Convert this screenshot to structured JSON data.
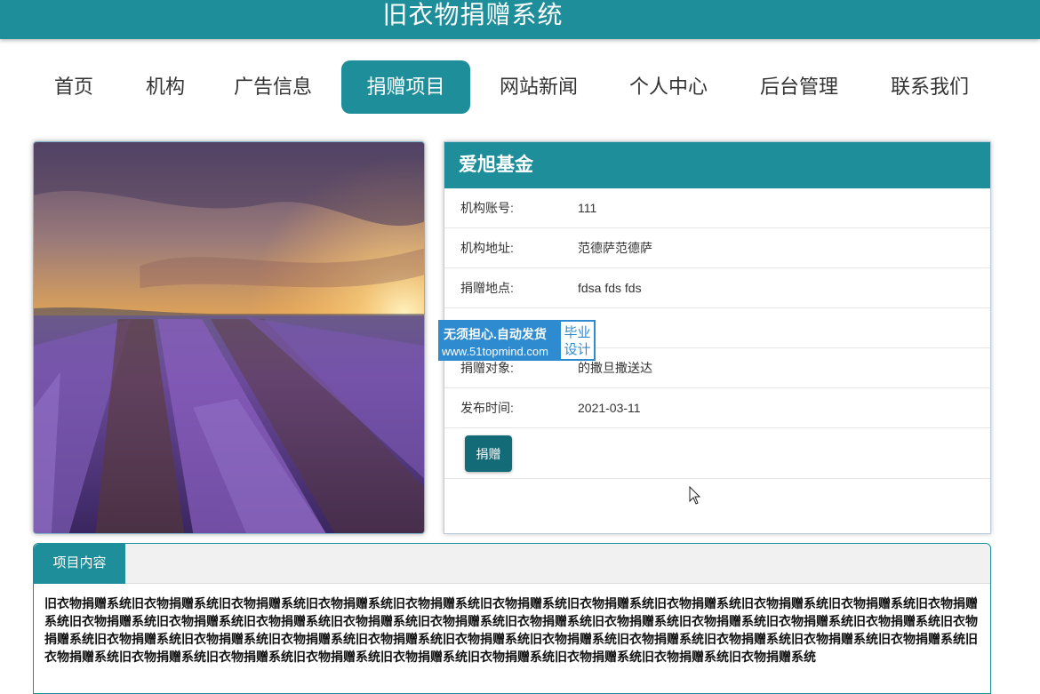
{
  "header": {
    "title": "旧衣物捐赠系统"
  },
  "nav": {
    "items": [
      {
        "label": "首页",
        "active": false
      },
      {
        "label": "机构",
        "active": false
      },
      {
        "label": "广告信息",
        "active": false
      },
      {
        "label": "捐赠项目",
        "active": true
      },
      {
        "label": "网站新闻",
        "active": false
      },
      {
        "label": "个人中心",
        "active": false
      },
      {
        "label": "后台管理",
        "active": false
      },
      {
        "label": "联系我们",
        "active": false
      }
    ]
  },
  "project": {
    "name": "爱旭基金",
    "fields": [
      {
        "label": "机构账号:",
        "value": "111"
      },
      {
        "label": "机构地址:",
        "value": "范德萨范德萨"
      },
      {
        "label": "捐赠地点:",
        "value": "fdsa fds fds"
      },
      {
        "label": "",
        "value": ""
      },
      {
        "label": "捐赠对象:",
        "value": "的撒旦撒送达"
      },
      {
        "label": "发布时间:",
        "value": "2021-03-11"
      }
    ],
    "donate_button": "捐赠"
  },
  "watermark": {
    "line1": "无须担心.自动发货",
    "line2": "www.51topmind.com",
    "badge": "毕业设计"
  },
  "content": {
    "tab_label": "项目内容",
    "text": "旧衣物捐赠系统旧衣物捐赠系统旧衣物捐赠系统旧衣物捐赠系统旧衣物捐赠系统旧衣物捐赠系统旧衣物捐赠系统旧衣物捐赠系统旧衣物捐赠系统旧衣物捐赠系统旧衣物捐赠系统旧衣物捐赠系统旧衣物捐赠系统旧衣物捐赠系统旧衣物捐赠系统旧衣物捐赠系统旧衣物捐赠系统旧衣物捐赠系统旧衣物捐赠系统旧衣物捐赠系统旧衣物捐赠系统旧衣物捐赠系统旧衣物捐赠系统旧衣物捐赠系统旧衣物捐赠系统旧衣物捐赠系统旧衣物捐赠系统旧衣物捐赠系统旧衣物捐赠系统旧衣物捐赠系统旧衣物捐赠系统旧衣物捐赠系统旧衣物捐赠系统旧衣物捐赠系统旧衣物捐赠系统旧衣物捐赠系统旧衣物捐赠系统旧衣物捐赠系统旧衣物捐赠系统旧衣物捐赠系统旧衣物捐赠系统"
  },
  "colors": {
    "primary": "#1e8f9a",
    "button": "#146b78",
    "watermark_blue": "#2e8bcf"
  },
  "icons": {
    "cursor": "mouse-pointer-icon",
    "photo": "lavender-field-image"
  }
}
